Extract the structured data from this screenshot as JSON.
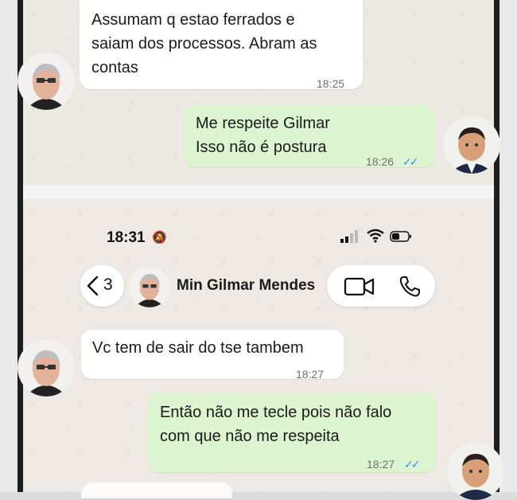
{
  "conversation_top": {
    "messages": [
      {
        "direction": "incoming",
        "text": "Assumam q estao ferrados e\nsaiam dos processos. Abram as\ncontas",
        "time": "18:25"
      },
      {
        "direction": "outgoing",
        "text": "Me respeite Gilmar\nIsso não é postura",
        "time": "18:26",
        "status": "read"
      }
    ]
  },
  "status_bar": {
    "time": "18:31",
    "icons": [
      "bell-mute-icon",
      "signal-icon",
      "wifi-icon",
      "battery-icon"
    ]
  },
  "chat_header": {
    "back_count": "3",
    "contact_name": "Min Gilmar Mendes",
    "icons": [
      "chevron-left-icon",
      "video-call-icon",
      "phone-call-icon"
    ]
  },
  "conversation_bottom": {
    "messages": [
      {
        "direction": "incoming",
        "text": "Vc tem de sair do tse tambem",
        "time": "18:27"
      },
      {
        "direction": "outgoing",
        "text": "Então não me tecle pois não falo\ncom que não me respeita",
        "time": "18:27",
        "status": "read"
      }
    ]
  },
  "colors": {
    "incoming_bubble": "#ffffff",
    "outgoing_bubble": "#dcf5d0",
    "read_ticks": "#3e8ef7",
    "chat_background": "#ece8e2"
  }
}
